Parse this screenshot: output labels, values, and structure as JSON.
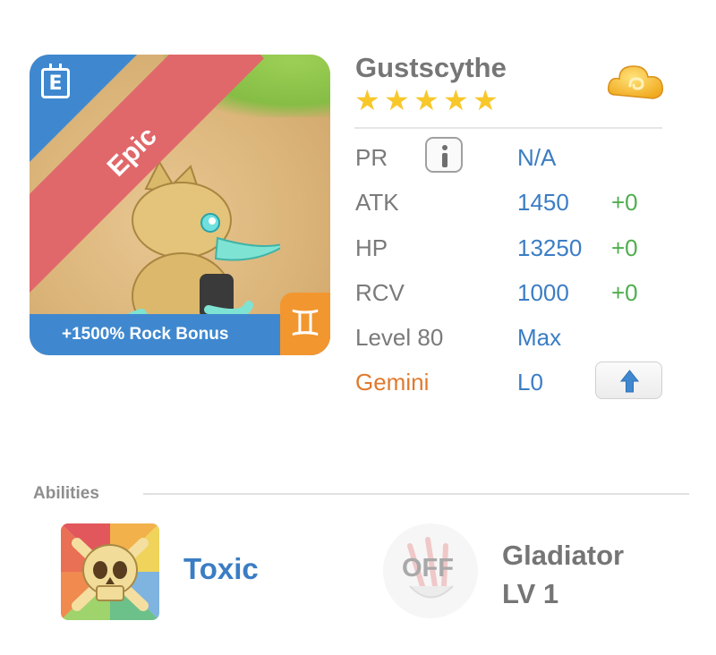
{
  "monster": {
    "name": "Gustscythe",
    "stars": 5,
    "rarity": "Epic",
    "bonus": "+1500% Rock Bonus",
    "zodiac_glyph": "♊",
    "calendar_letter": "E"
  },
  "stats": {
    "pr": {
      "label": "PR",
      "value": "N/A"
    },
    "atk": {
      "label": "ATK",
      "value": "1450",
      "delta": "+0"
    },
    "hp": {
      "label": "HP",
      "value": "13250",
      "delta": "+0"
    },
    "rcv": {
      "label": "RCV",
      "value": "1000",
      "delta": "+0"
    },
    "level": {
      "label": "Level 80",
      "value": "Max"
    },
    "zodiac": {
      "label": "Gemini",
      "value": "L0"
    }
  },
  "abilities": {
    "title": "Abilities",
    "items": [
      {
        "name": "Toxic",
        "icon": "skull-icon"
      },
      {
        "name": "Gladiator",
        "level": "LV 1",
        "state": "OFF",
        "icon": "claw-icon"
      }
    ]
  },
  "colors": {
    "epic_ribbon": "#e0686a",
    "blue": "#3f88cf",
    "value_blue": "#3b7dc4",
    "delta_green": "#4fae4f",
    "zodiac_orange": "#f2962f",
    "star_yellow": "#f8c72a"
  }
}
